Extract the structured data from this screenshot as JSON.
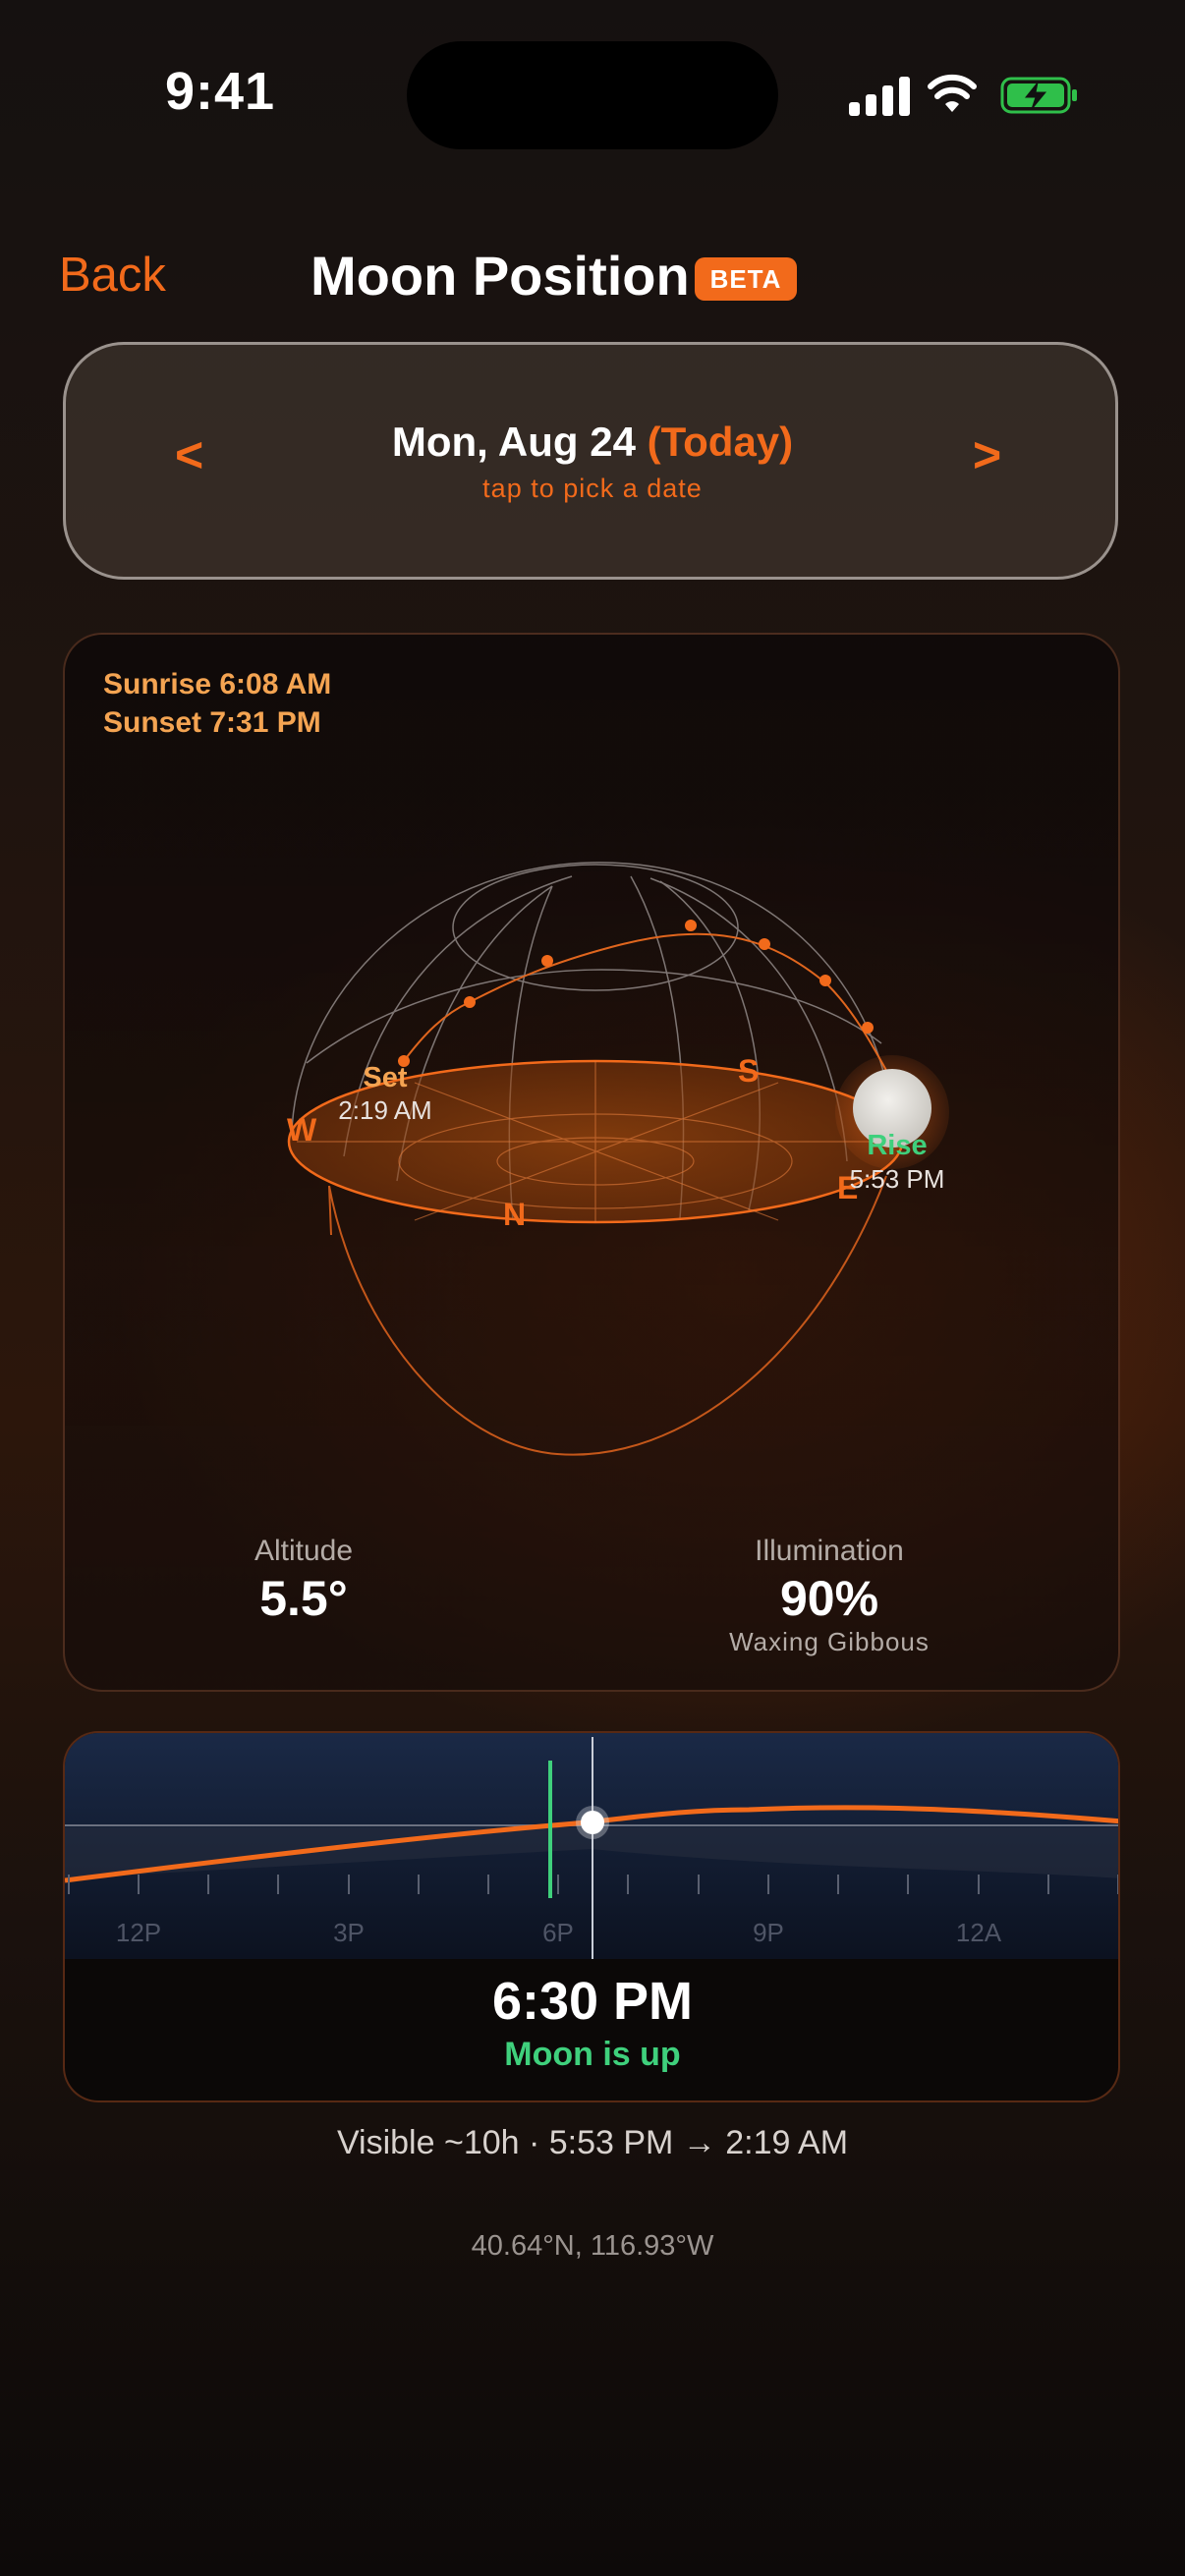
{
  "status_bar": {
    "time": "9:41"
  },
  "header": {
    "back_label": "Back",
    "title": "Moon Position",
    "badge": "BETA"
  },
  "date_picker": {
    "prev": "<",
    "next": ">",
    "date": "Mon, Aug 24",
    "today_label": "(Today)",
    "hint": "tap to pick a date"
  },
  "sky": {
    "sunrise": "Sunrise 6:08 AM",
    "sunset": "Sunset 7:31 PM",
    "compass": {
      "w": "W",
      "s": "S",
      "n": "N",
      "e": "E"
    },
    "set_label": "Set",
    "set_time": "2:19 AM",
    "rise_label": "Rise",
    "rise_time": "5:53 PM",
    "altitude_label": "Altitude",
    "altitude_value": "5.5°",
    "illumination_label": "Illumination",
    "illumination_value": "90%",
    "phase": "Waxing Gibbous"
  },
  "timeline": {
    "ticks": [
      "12P",
      "3P",
      "6P",
      "9P",
      "12A"
    ],
    "time": "6:30 PM",
    "status": "Moon is up"
  },
  "visibility": "Visible ~10h · 5:53 PM → 2:19 AM",
  "coordinates": "40.64°N, 116.93°W",
  "colors": {
    "accent": "#f26a1b",
    "up": "#3fd07c",
    "sun": "#f4a452"
  }
}
